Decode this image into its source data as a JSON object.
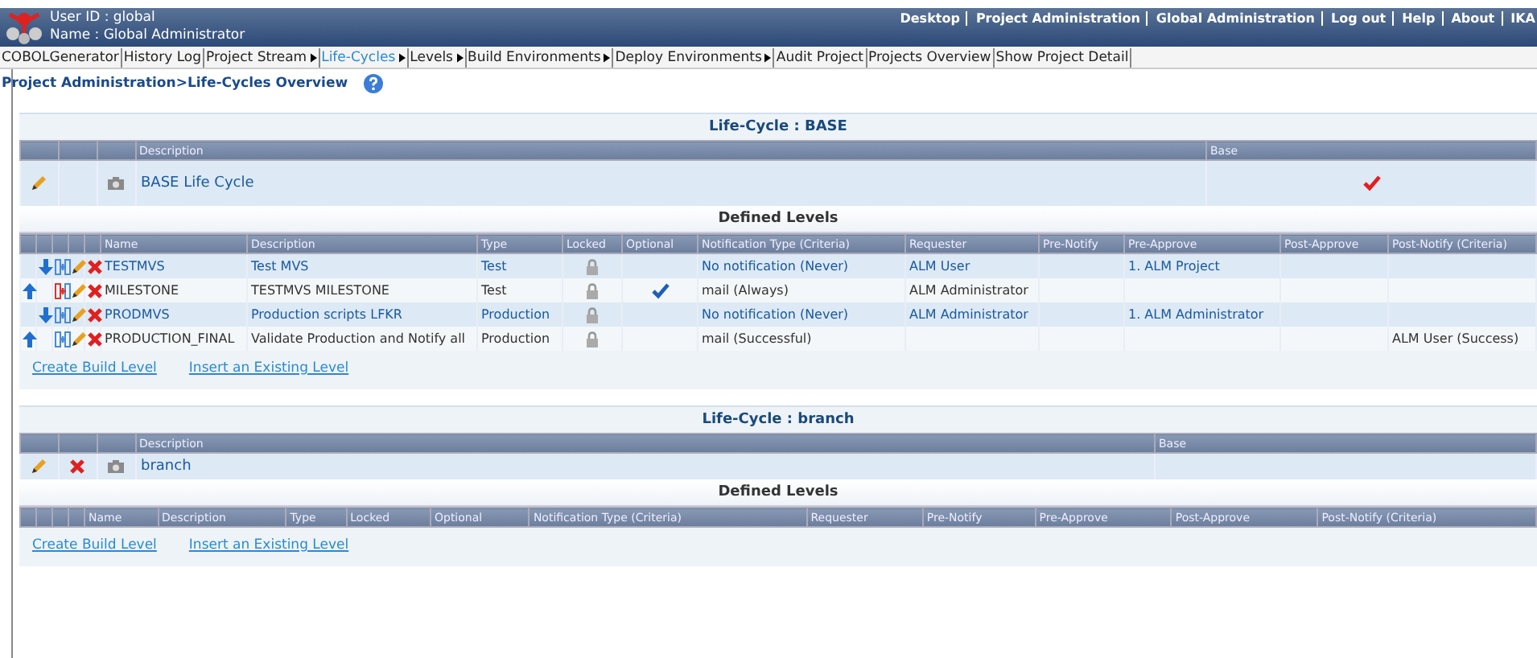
{
  "header": {
    "user_id": "User ID : global",
    "user_name": "Name : Global Administrator",
    "links": [
      "Desktop",
      "Project Administration",
      "Global Administration",
      "Log out",
      "Help",
      "About",
      "IKA"
    ]
  },
  "menu": [
    {
      "label": "COBOLGenerator",
      "has_submenu": false,
      "selected": false
    },
    {
      "label": "History Log",
      "has_submenu": false,
      "selected": false
    },
    {
      "label": "Project Stream",
      "has_submenu": true,
      "selected": false
    },
    {
      "label": "Life-Cycles",
      "has_submenu": true,
      "selected": true
    },
    {
      "label": "Levels",
      "has_submenu": true,
      "selected": false
    },
    {
      "label": "Build Environments",
      "has_submenu": true,
      "selected": false
    },
    {
      "label": "Deploy Environments",
      "has_submenu": true,
      "selected": false
    },
    {
      "label": "Audit Project",
      "has_submenu": false,
      "selected": false
    },
    {
      "label": "Projects Overview",
      "has_submenu": false,
      "selected": false
    },
    {
      "label": "Show Project Detail",
      "has_submenu": false,
      "selected": false
    }
  ],
  "breadcrumb": "Project Administration>Life-Cycles Overview",
  "life_cycles": [
    {
      "title": "Life-Cycle : BASE",
      "columns": [
        "Description",
        "Base"
      ],
      "description": "BASE Life Cycle",
      "base": true,
      "deletable": false,
      "levels_title": "Defined Levels",
      "level_columns": [
        "Name",
        "Description",
        "Type",
        "Locked",
        "Optional",
        "Notification Type (Criteria)",
        "Requester",
        "Pre-Notify",
        "Pre-Approve",
        "Post-Approve",
        "Post-Notify (Criteria)"
      ],
      "levels": [
        {
          "move_up": false,
          "move_down": true,
          "warning": false,
          "name": "TESTMVS",
          "description": "Test MVS",
          "type": "Test",
          "locked": true,
          "optional": false,
          "notification": "No notification (Never)",
          "requester": "ALM User",
          "pre_approve": "1. ALM Project"
        },
        {
          "move_up": true,
          "move_down": false,
          "warning": true,
          "name": "MILESTONE",
          "description": "TESTMVS MILESTONE",
          "type": "Test",
          "locked": true,
          "optional": true,
          "notification": "mail (Always)",
          "requester": "ALM Administrator"
        },
        {
          "move_up": false,
          "move_down": true,
          "warning": false,
          "name": "PRODMVS",
          "description": "Production scripts LFKR",
          "type": "Production",
          "locked": true,
          "optional": false,
          "notification": "No notification (Never)",
          "requester": "ALM Administrator",
          "pre_approve": "1. ALM Administrator"
        },
        {
          "move_up": true,
          "move_down": false,
          "warning": false,
          "name": "PRODUCTION_FINAL",
          "description": "Validate Production and Notify all",
          "type": "Production",
          "locked": true,
          "optional": false,
          "notification": "mail (Successful)",
          "post_notify": "ALM User (Success)"
        }
      ],
      "actions": [
        "Create Build Level",
        "Insert an Existing Level"
      ]
    },
    {
      "title": "Life-Cycle : branch",
      "columns": [
        "Description",
        "Base"
      ],
      "description": "branch",
      "base": false,
      "deletable": true,
      "levels_title": "Defined Levels",
      "level_columns": [
        "Name",
        "Description",
        "Type",
        "Locked",
        "Optional",
        "Notification Type (Criteria)",
        "Requester",
        "Pre-Notify",
        "Pre-Approve",
        "Post-Approve",
        "Post-Notify (Criteria)"
      ],
      "actions": [
        "Create Build Level",
        "Insert an Existing Level"
      ]
    }
  ]
}
